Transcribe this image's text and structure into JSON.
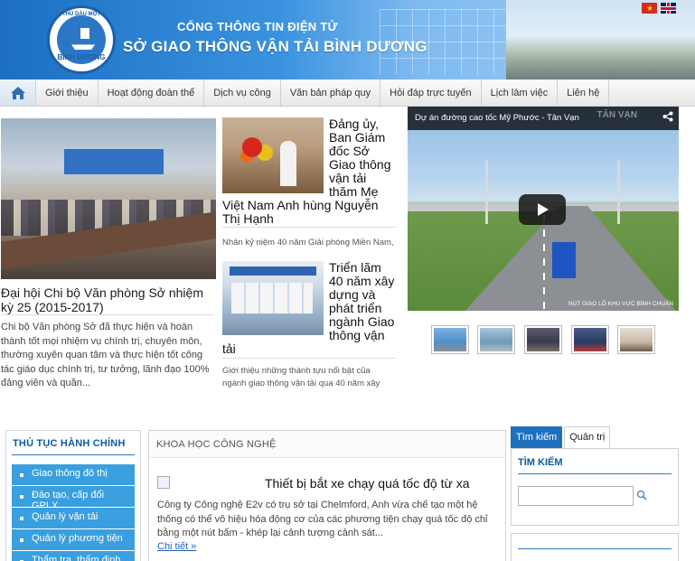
{
  "header": {
    "subtitle": "CỔNG THÔNG TIN ĐIỆN TỬ",
    "title": "SỞ GIAO THÔNG VẬN TẢI BÌNH DƯƠNG",
    "logo_top": "THỦ DẦU MỘT",
    "logo_name": "BÌNH DƯƠNG",
    "flag_vn": "vietnam-flag-icon",
    "flag_uk": "uk-flag-icon"
  },
  "nav": {
    "home_icon": "home-icon",
    "items": [
      {
        "label": "Giới thiệu"
      },
      {
        "label": "Hoạt động đoàn thể"
      },
      {
        "label": "Dịch vụ công"
      },
      {
        "label": "Văn bản pháp quy"
      },
      {
        "label": "Hỏi đáp trực tuyến"
      },
      {
        "label": "Lịch làm việc"
      },
      {
        "label": "Liên hệ"
      }
    ]
  },
  "featured": {
    "title": "Đại hội Chi bộ Văn phòng Sở nhiệm kỳ 25 (2015-2017)",
    "description": "Chi bộ Văn phòng Sở đã thực hiện và hoàn thành tốt mọi nhiệm vụ chính trị, chuyên môn, thường xuyên quan tâm và thực hiện tốt công tác giáo dục chính trị, tư tưởng, lãnh đạo 100% đảng viên và quần..."
  },
  "news": [
    {
      "title": "Đảng ủy, Ban Giám đốc Sở Giao thông vận tải thăm Mẹ Việt Nam Anh hùng Nguyễn Thị Hạnh",
      "title_side": "Đảng ủy, Ban Giám đốc Sở Giao thông vận tải thăm Mẹ",
      "title_rest": "Việt Nam Anh hùng Nguyễn Thị Hạnh",
      "description": "Nhân kỷ niệm 40 năm Giải phóng Miền Nam,"
    },
    {
      "title_side": "Triển lãm 40 năm xây dựng và phát triển ngành Giao thông vận",
      "title_rest": "tải",
      "description": "Giới thiệu những thành tựu nổi bật của ngành giao thông vận tải qua 40 năm xây"
    }
  ],
  "video": {
    "title": "Dự án đường cao tốc Mỹ Phước - Tân Vạn",
    "watermark": "TÂN VẠN",
    "caption": "NÚT GIAO LỘ KHU VỰC BÌNH CHUẨN",
    "share_icon": "share-icon",
    "play_icon": "play-icon",
    "thumb_colors": [
      "#4f8fc9",
      "#6d9ab8",
      "#3b3b4f",
      "#2a3b66",
      "#c9b9a6"
    ]
  },
  "left_panel": {
    "heading": "THỦ TỤC HÀNH CHÍNH",
    "items": [
      {
        "label": "Giao thông đô thị"
      },
      {
        "label": "Đào tạo, cấp đổi GPLX"
      },
      {
        "label": "Quản lý vận tải"
      },
      {
        "label": "Quản lý phương tiện"
      },
      {
        "label": "Thẩm tra, thẩm định CT"
      }
    ]
  },
  "mid_panel": {
    "heading": "KHOA HỌC CÔNG NGHỆ",
    "article_title": "Thiết bị bắt xe chạy quá tốc độ từ xa",
    "article_desc": "Công ty Công nghệ E2v có trụ sở tại Chelmford, Anh vừa chế tạo một hệ thống có thể vô hiệu hóa động cơ của các phương tiện chạy quá tốc độ chỉ bằng một nút bấm - khép lại cảnh tượng cảnh sát...",
    "more_link": "Chi tiết »"
  },
  "right_panel": {
    "tabs": [
      {
        "label": "Tìm kiếm"
      },
      {
        "label": "Quản trị"
      }
    ],
    "heading": "TÌM KIẾM",
    "search_placeholder": "",
    "search_icon": "search-icon"
  },
  "colors": {
    "brand_blue": "#1f6fbf",
    "menu_blue": "#3a9fde",
    "heading_blue": "#0b5aa7"
  }
}
